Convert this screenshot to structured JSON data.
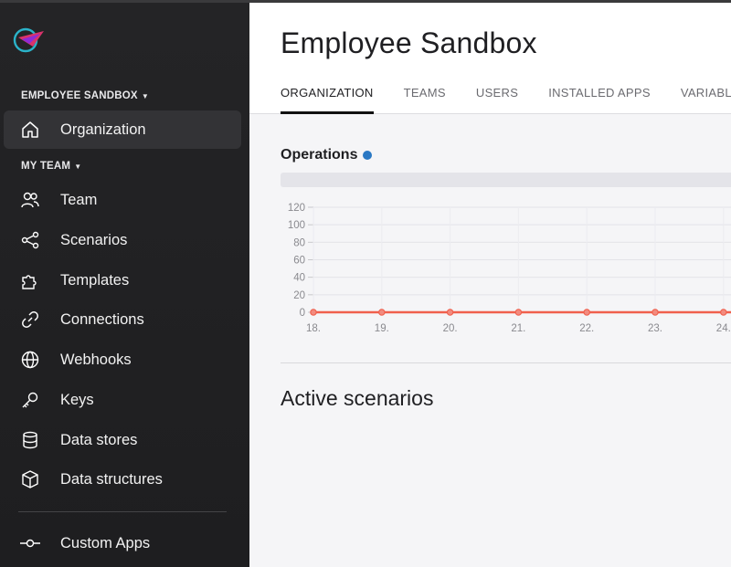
{
  "sidebar": {
    "org_section": "EMPLOYEE SANDBOX",
    "org_item": "Organization",
    "team_section": "MY TEAM",
    "items": [
      {
        "label": "Team",
        "icon": "team-icon"
      },
      {
        "label": "Scenarios",
        "icon": "share-nodes-icon"
      },
      {
        "label": "Templates",
        "icon": "puzzle-icon"
      },
      {
        "label": "Connections",
        "icon": "link-icon"
      },
      {
        "label": "Webhooks",
        "icon": "globe-icon"
      },
      {
        "label": "Keys",
        "icon": "key-icon"
      },
      {
        "label": "Data stores",
        "icon": "database-icon"
      },
      {
        "label": "Data structures",
        "icon": "cube-icon"
      }
    ],
    "custom_apps": "Custom Apps"
  },
  "header": {
    "title": "Employee Sandbox",
    "tabs": [
      "ORGANIZATION",
      "TEAMS",
      "USERS",
      "INSTALLED APPS",
      "VARIABLES"
    ],
    "active_tab": 0
  },
  "operations": {
    "title": "Operations",
    "dot_color": "#2a78c4"
  },
  "chart_data": {
    "type": "line",
    "categories": [
      "18.",
      "19.",
      "20.",
      "21.",
      "22.",
      "23.",
      "24."
    ],
    "series": [
      {
        "values": [
          0,
          0,
          0,
          0,
          0,
          0,
          0
        ],
        "color": "#f0604d"
      }
    ],
    "yticks": [
      0,
      20,
      40,
      60,
      80,
      100,
      120
    ],
    "ylim": [
      0,
      120
    ],
    "grid": true
  },
  "active_scenarios": {
    "title": "Active scenarios"
  }
}
